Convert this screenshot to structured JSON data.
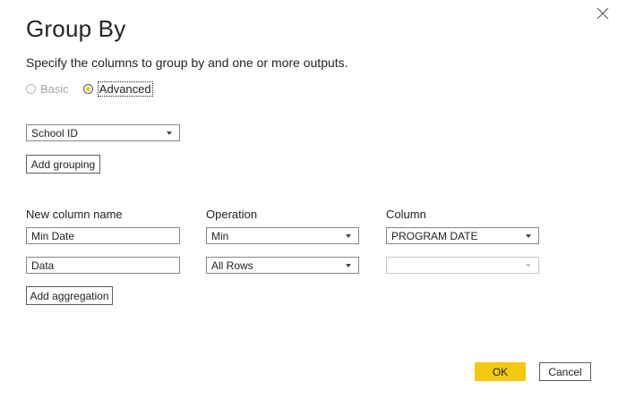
{
  "dialog": {
    "title": "Group By",
    "subtitle": "Specify the columns to group by and one or more outputs."
  },
  "mode": {
    "basic_label": "Basic",
    "advanced_label": "Advanced",
    "selected": "Advanced"
  },
  "grouping": {
    "columns": [
      "School ID"
    ],
    "add_button_label": "Add grouping"
  },
  "aggregations": {
    "headers": {
      "new_column": "New column name",
      "operation": "Operation",
      "column": "Column"
    },
    "rows": [
      {
        "name": "Min Date",
        "operation": "Min",
        "column": "PROGRAM DATE"
      },
      {
        "name": "Data",
        "operation": "All Rows",
        "column": ""
      }
    ],
    "add_button_label": "Add aggregation"
  },
  "footer": {
    "ok_label": "OK",
    "cancel_label": "Cancel"
  },
  "colors": {
    "accent": "#f2c811",
    "border": "#8a8886",
    "text": "#252423",
    "disabled": "#a6a6a6"
  },
  "icons": {
    "close": "close-icon",
    "dropdown": "chevron-down-icon"
  }
}
